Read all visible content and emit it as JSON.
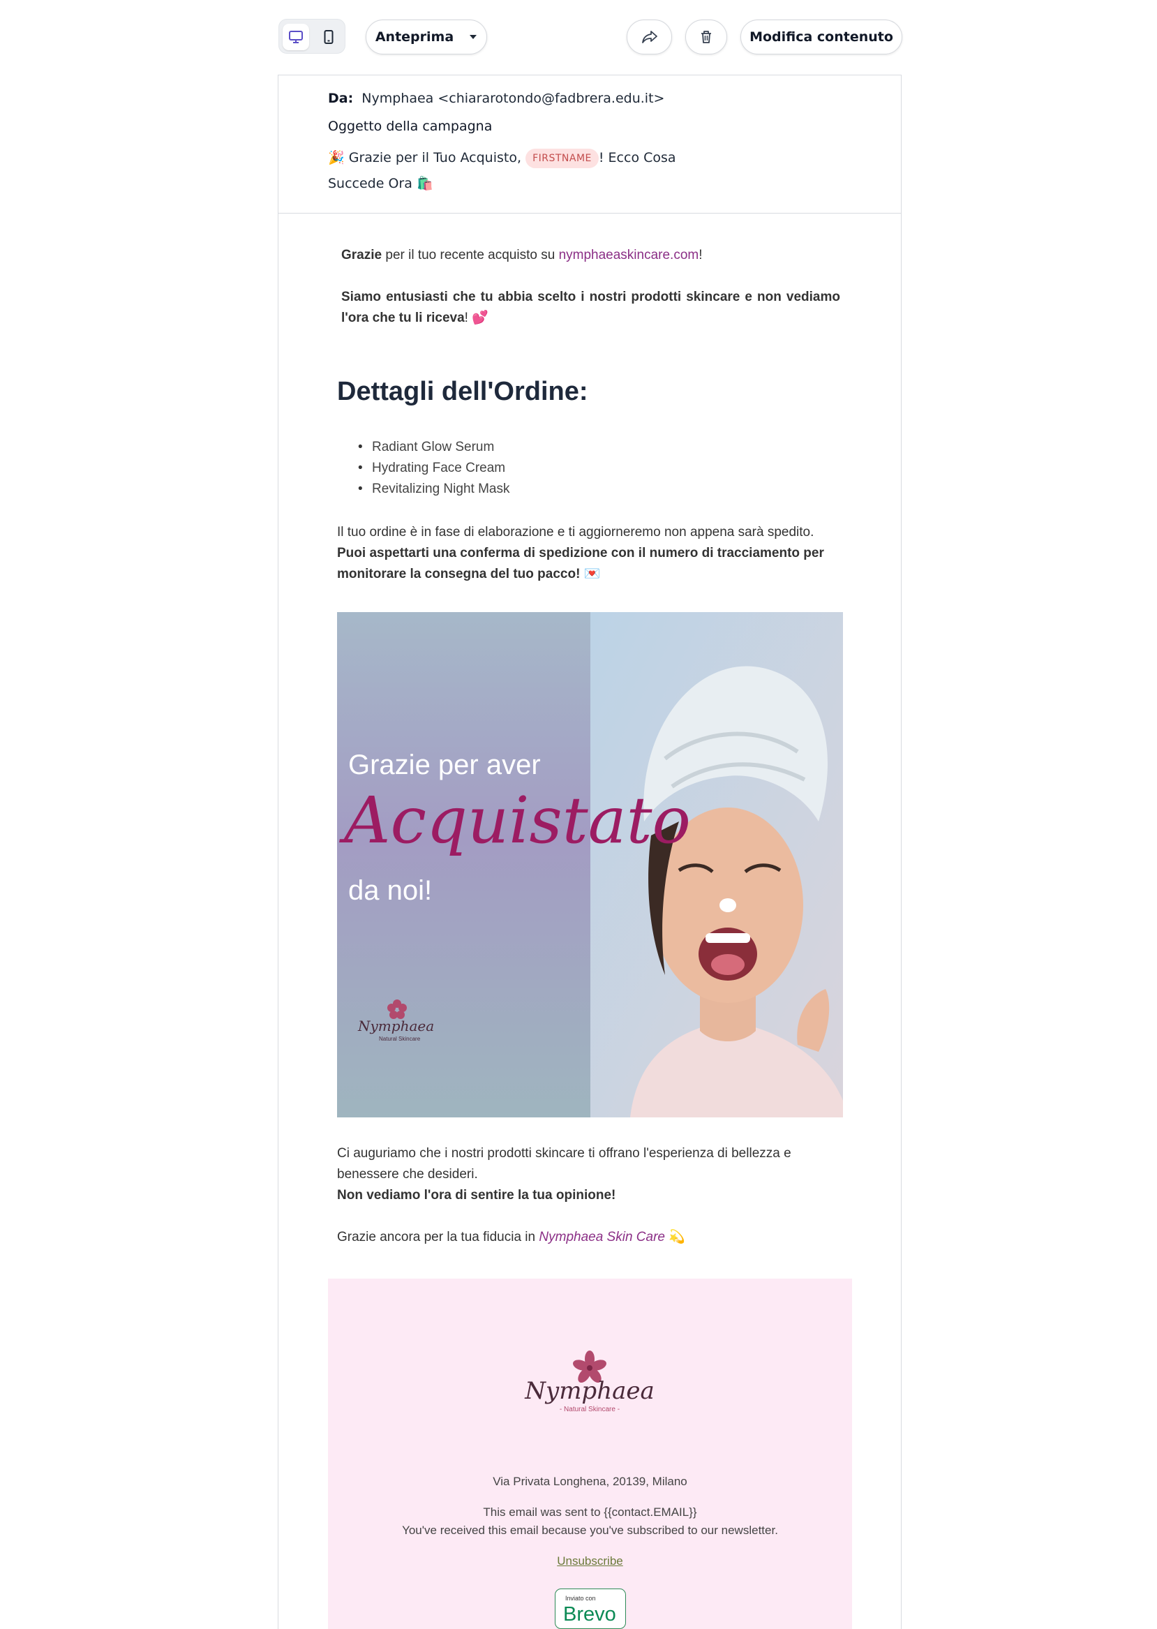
{
  "toolbar": {
    "preview_label": "Anteprima",
    "edit_label": "Modifica contenuto"
  },
  "header": {
    "from_label": "Da:",
    "from_value": "Nymphaea <chiararotondo@fadbrera.edu.it>",
    "subject_label": "Oggetto della campagna",
    "subject_emoji_start": "🎉",
    "subject_part1": "Grazie per il Tuo Acquisto,",
    "subject_tag": "FIRSTNAME",
    "subject_part2": "! Ecco Cosa Succede Ora",
    "subject_emoji_end": "🛍️"
  },
  "body": {
    "intro_bold": "Grazie",
    "intro_text": " per il tuo recente acquisto su ",
    "intro_link": "nymphaeaskincare.com",
    "intro_end": "!",
    "intro2": "Siamo entusiasti che tu abbia scelto i nostri prodotti skincare e non vediamo l'ora che tu li riceva",
    "intro2_end": "! 💕",
    "heading": "Dettagli dell'Ordine:",
    "order_items": [
      "Radiant Glow Serum",
      "Hydrating Face Cream",
      "Revitalizing Night Mask"
    ],
    "status_text": "Il tuo ordine è in fase di elaborazione e ti aggiorneremo non appena sarà spedito.",
    "status_bold": "Puoi aspettarti una conferma di spedizione con il numero di tracciamento per monitorare la consegna del tuo pacco! 💌",
    "banner_line1": "Grazie per aver",
    "banner_script": "Acquistato",
    "banner_line3": "da noi!",
    "banner_logo": "Nymphaea",
    "banner_logo_sub": "Natural Skincare",
    "closing_text": "Ci auguriamo che i nostri prodotti skincare ti offrano l'esperienza di bellezza e benessere che desideri.",
    "closing_bold": "Non vediamo l'ora di sentire la tua opinione!",
    "thanks_text": "Grazie ancora per la tua fiducia in ",
    "thanks_brand": "Nymphaea Skin Care",
    "thanks_emoji": "💫"
  },
  "footer": {
    "logo_text": "Nymphaea",
    "logo_sub": "- Natural Skincare -",
    "address": "Via Privata Longhena, 20139, Milano",
    "sent_to": "This email was sent to {{contact.EMAIL}}",
    "reason": "You've received this email because you've subscribed to our newsletter.",
    "unsubscribe": "Unsubscribe",
    "badge_small": "Inviato con",
    "badge_brand": "Brevo"
  },
  "colors": {
    "accent_purple": "#5b4ec7",
    "link_magenta": "#8b2f86",
    "footer_pink": "#fdeaf5",
    "brevo_green": "#0b8a55"
  }
}
